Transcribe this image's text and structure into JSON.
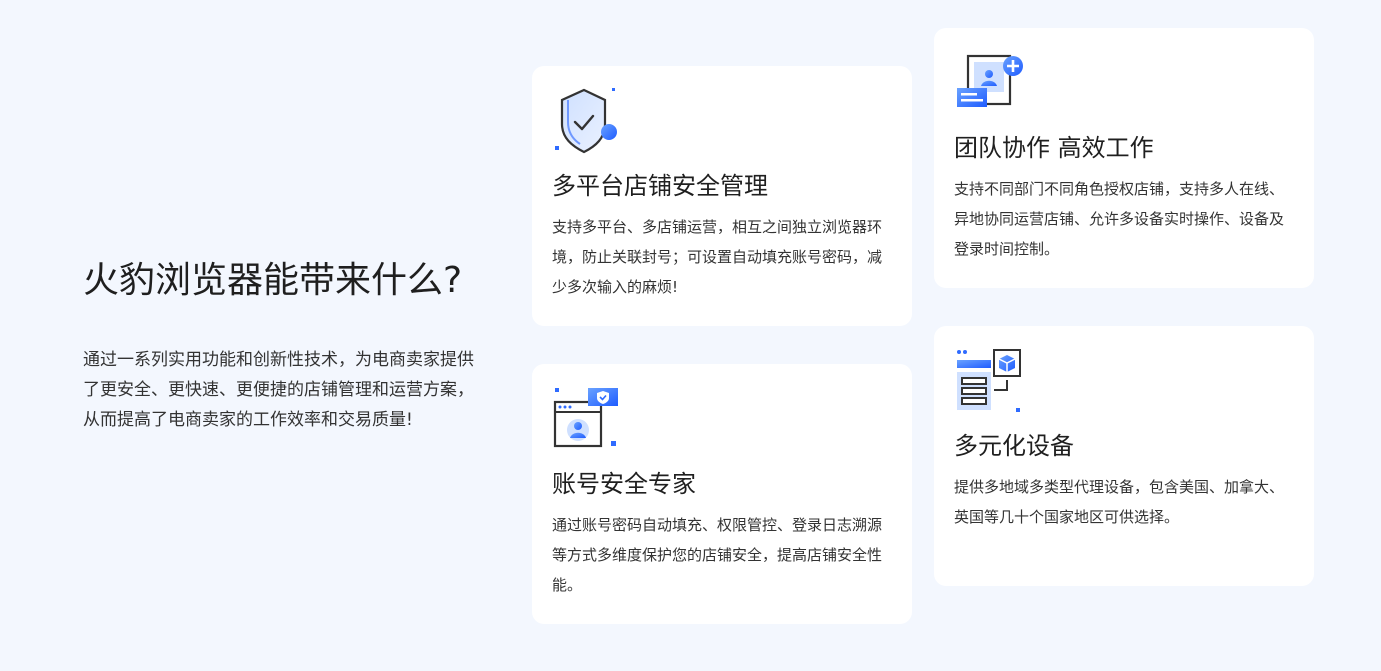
{
  "intro": {
    "title": "火豹浏览器能带来什么?",
    "description": "通过一系列实用功能和创新性技术，为电商卖家提供了更安全、更快速、更便捷的店铺管理和运营方案，从而提高了电商卖家的工作效率和交易质量!"
  },
  "cards": {
    "multiplatform": {
      "icon": "shield-check-icon",
      "title": "多平台店铺安全管理",
      "description": "支持多平台、多店铺运营，相互之间独立浏览器环境，防止关联封号；可设置自动填充账号密码，减少多次输入的麻烦!"
    },
    "account": {
      "icon": "browser-user-shield-icon",
      "title": "账号安全专家",
      "description": "通过账号密码自动填充、权限管控、登录日志溯源等方式多维度保护您的店铺安全，提高店铺安全性能。"
    },
    "team": {
      "icon": "team-add-user-icon",
      "title": "团队协作 高效工作",
      "description": "支持不同部门不同角色授权店铺，支持多人在线、异地协同运营店铺、允许多设备实时操作、设备及登录时间控制。"
    },
    "devices": {
      "icon": "server-devices-icon",
      "title": "多元化设备",
      "description": "提供多地域多类型代理设备，包含美国、加拿大、英国等几十个国家地区可供选择。"
    }
  },
  "colors": {
    "page_background": "#f3f7fe",
    "card_background": "#ffffff",
    "accent_blue": "#2f6bff",
    "icon_dark": "#333333"
  }
}
